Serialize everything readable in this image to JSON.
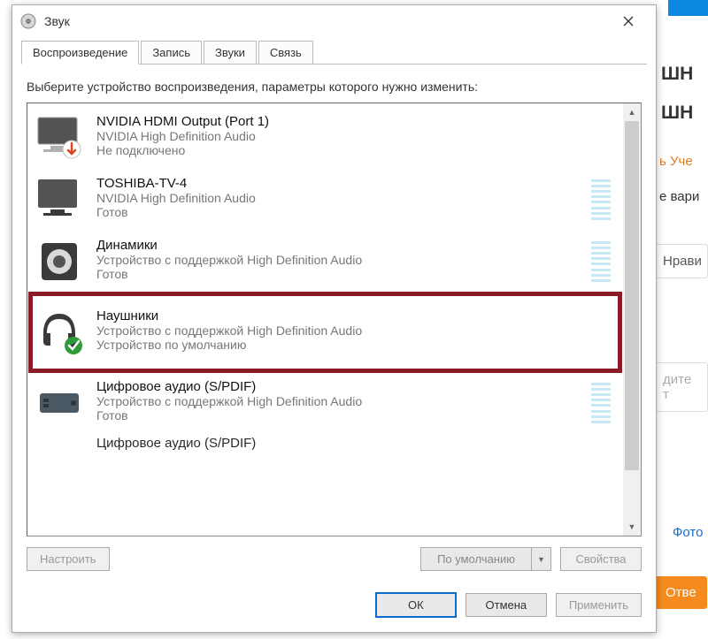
{
  "dialog": {
    "title": "Звук",
    "tabs": [
      {
        "label": "Воспроизведение",
        "active": true
      },
      {
        "label": "Запись",
        "active": false
      },
      {
        "label": "Звуки",
        "active": false
      },
      {
        "label": "Связь",
        "active": false
      }
    ],
    "instruction": "Выберите устройство воспроизведения, параметры которого нужно изменить:",
    "devices": [
      {
        "name": "NVIDIA HDMI Output (Port 1)",
        "driver": "NVIDIA High Definition Audio",
        "status": "Не подключено",
        "icon": "monitor-disconnected",
        "meter": false,
        "highlight": false
      },
      {
        "name": "TOSHIBA-TV-4",
        "driver": "NVIDIA High Definition Audio",
        "status": "Готов",
        "icon": "monitor",
        "meter": true,
        "highlight": false
      },
      {
        "name": "Динамики",
        "driver": "Устройство с поддержкой High Definition Audio",
        "status": "Готов",
        "icon": "speaker",
        "meter": true,
        "highlight": false
      },
      {
        "name": "Наушники",
        "driver": "Устройство с поддержкой High Definition Audio",
        "status": "Устройство по умолчанию",
        "icon": "headphones-default",
        "meter": true,
        "highlight": true
      },
      {
        "name": "Цифровое аудио (S/PDIF)",
        "driver": "Устройство с поддержкой High Definition Audio",
        "status": "Готов",
        "icon": "digital-audio",
        "meter": true,
        "highlight": false
      },
      {
        "name": "Цифровое аудио (S/PDIF)",
        "driver": "",
        "status": "",
        "icon": "",
        "meter": false,
        "highlight": false
      }
    ],
    "buttons": {
      "configure": "Настроить",
      "set_default": "По умолчанию",
      "properties": "Свойства",
      "ok": "ОК",
      "cancel": "Отмена",
      "apply": "Применить"
    }
  },
  "background": {
    "heading1": "ШН",
    "heading2": "ШН",
    "text_account": "ь Уче",
    "text_variant": "е вари",
    "text_like": "Нрави",
    "text_enter": "дите т",
    "text_photo": "Фото",
    "answer_btn": "Отве"
  }
}
